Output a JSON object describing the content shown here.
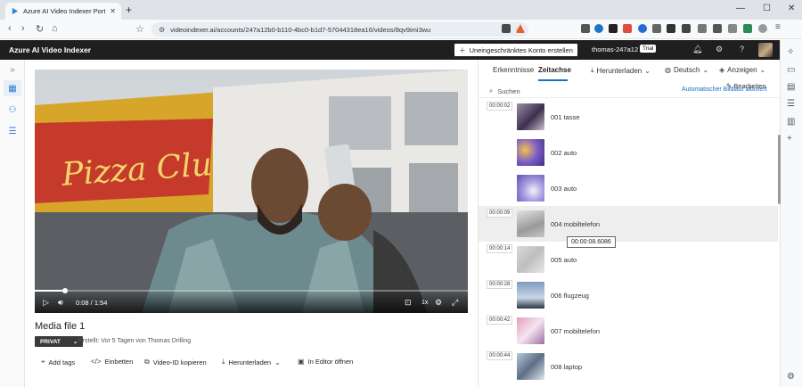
{
  "browser": {
    "tab_title": "Azure AI Video Indexer Portal",
    "tab_close": "✕",
    "new_tab": "+",
    "url": "videoindexer.ai/accounts/247a12b0-b110-4bc0-b1d7-57044318ea16/videos/8qv9imi3wu",
    "window_controls": [
      "—",
      "☐",
      "✕"
    ]
  },
  "app": {
    "title": "Azure AI Video Indexer",
    "create_account_label": "Uneingeschränktes Konto erstellen",
    "user_name": "thomas-247a12",
    "trial_badge": "Trial"
  },
  "player": {
    "time": "0:08 / 1:54",
    "speed": "1x",
    "progress": 0.07
  },
  "media": {
    "title": "Media file 1",
    "privacy": "PRIVAT",
    "created": "Erstellt: Vor 5 Tagen von Thomas Drilling",
    "actions": {
      "add_tags": "Add tags",
      "embed": "Einbetten",
      "copy_id": "Video-ID kopieren",
      "download": "Herunterladen",
      "open_editor": "In Editor öffnen"
    }
  },
  "panel": {
    "tabs": {
      "insights": "Erkenntnisse",
      "timeline": "Zeitachse"
    },
    "menus": {
      "download": "Herunterladen",
      "language": "Deutsch",
      "view": "Anzeigen"
    },
    "edit": "Bearbeiten",
    "search_placeholder": "Suchen",
    "autoscroll": "Automatischer Bildlauf aktiviert",
    "tooltip": "00:00:08.6086",
    "rows": [
      {
        "time": "00:00:02",
        "label": "001 tasse"
      },
      {
        "time": "",
        "label": "002 auto"
      },
      {
        "time": "",
        "label": "003 auto"
      },
      {
        "time": "00:00:09",
        "label": "004 mobiltelefon"
      },
      {
        "time": "00:00:14",
        "label": "005 auto"
      },
      {
        "time": "00:00:28",
        "label": "006 flugzeug"
      },
      {
        "time": "00:00:42",
        "label": "007 mobiltelefon"
      },
      {
        "time": "00:00:44",
        "label": "008 laptop"
      }
    ]
  }
}
